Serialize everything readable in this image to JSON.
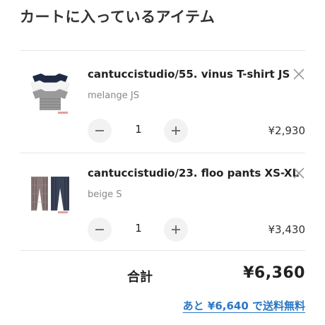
{
  "page": {
    "title": "カートに入っているアイテム"
  },
  "items": [
    {
      "name": "cantuccistudio/55. vinus T-shirt JS",
      "variant": "melange JS",
      "quantity": "1",
      "price": "¥2,930",
      "thumbnail_icon": "tshirt-stack-image"
    },
    {
      "name": "cantuccistudio/23. floo pants XS-XL",
      "variant": "beige S",
      "quantity": "1",
      "price": "¥3,430",
      "thumbnail_icon": "pants-pair-image"
    }
  ],
  "summary": {
    "total_label": "合計",
    "total_value": "¥6,360",
    "free_shipping_text": "あと ¥6,640 で送料無料"
  },
  "colors": {
    "link": "#2b78c5",
    "divider": "#e6e6e6",
    "qty_button_bg": "#f2f2f2"
  }
}
